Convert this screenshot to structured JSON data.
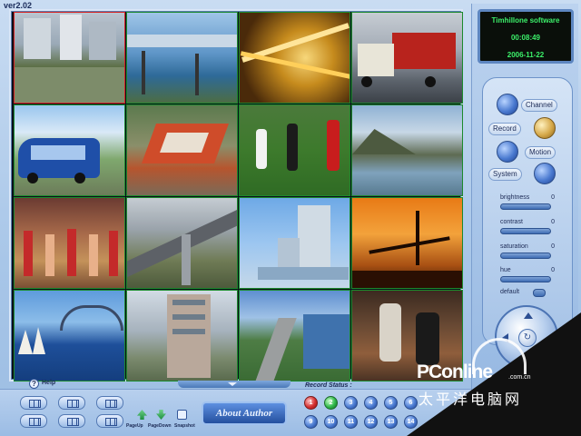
{
  "app": {
    "version": "ver2.02"
  },
  "clock": {
    "company": "Timhillone software",
    "time": "00:08:49",
    "date": "2006-11-22"
  },
  "controls": {
    "channel": "Channel",
    "record": "Record",
    "motion": "Motion",
    "system": "System"
  },
  "adjust": [
    {
      "label": "brightness",
      "value": "0"
    },
    {
      "label": "contrast",
      "value": "0"
    },
    {
      "label": "saturation",
      "value": "0"
    },
    {
      "label": "hue",
      "value": "0"
    }
  ],
  "default_label": "default",
  "bottom": {
    "help": "Help",
    "record_status": "Record Status :",
    "about": "About Author",
    "tools": [
      {
        "label": "PageUp",
        "icon": "page-up-icon"
      },
      {
        "label": "PageDown",
        "icon": "page-down-icon"
      },
      {
        "label": "Snapshot",
        "icon": "snapshot-icon"
      }
    ],
    "channels_row1": [
      "1",
      "2",
      "3",
      "4",
      "5",
      "6"
    ],
    "channels_row2": [
      "9",
      "10",
      "11",
      "12",
      "13",
      "14"
    ]
  },
  "camera_active_index": 0,
  "colors": {
    "clock_text": "#3cf06a",
    "active_border": "#d62020",
    "cell_border": "#1b8a2c"
  },
  "watermark": {
    "brand": "PConline",
    "domain": ".com.cn",
    "chinese": "太平洋电脑网"
  }
}
